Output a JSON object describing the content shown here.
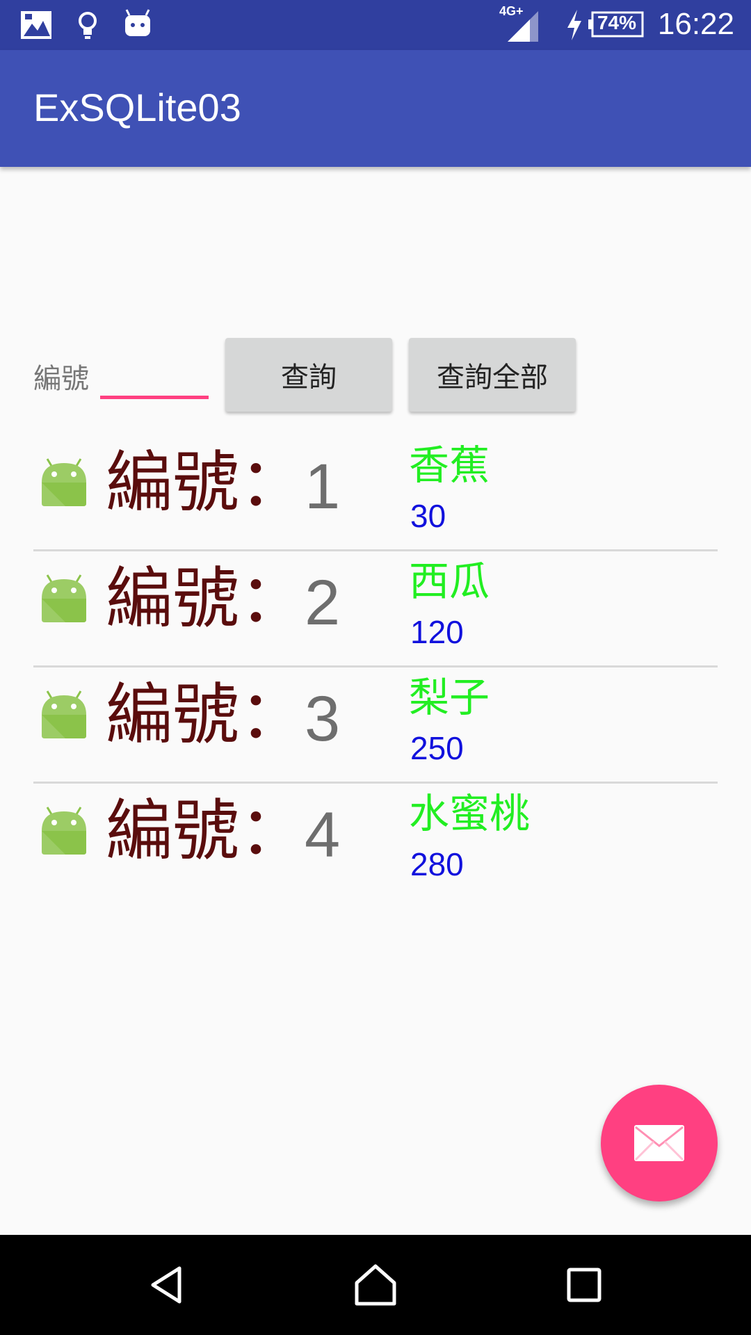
{
  "status_bar": {
    "network": "4G+",
    "battery": "74%",
    "time": "16:22",
    "icons": [
      "photo-notification-icon",
      "lightbulb-icon",
      "android-notification-icon",
      "signal-icon",
      "charging-bolt-icon",
      "battery-icon"
    ]
  },
  "app_bar": {
    "title": "ExSQLite03"
  },
  "query": {
    "id_label": "編號",
    "id_value": "",
    "query_button": "查詢",
    "query_all_button": "查詢全部"
  },
  "list": [
    {
      "caption": "編號：",
      "id": "1",
      "name": "香蕉",
      "price": "30"
    },
    {
      "caption": "編號：",
      "id": "2",
      "name": "西瓜",
      "price": "120"
    },
    {
      "caption": "編號：",
      "id": "3",
      "name": "梨子",
      "price": "250"
    },
    {
      "caption": "編號：",
      "id": "4",
      "name": "水蜜桃",
      "price": "280"
    }
  ],
  "fab": {
    "icon": "email-icon"
  },
  "nav_bar": {
    "icons": [
      "back-icon",
      "home-icon",
      "recents-icon"
    ]
  },
  "colors": {
    "status_bar": "#303f9f",
    "app_bar": "#3f51b5",
    "accent": "#ff4081",
    "caption": "#5a0d0d",
    "name": "#22ee22",
    "price": "#1111dd"
  }
}
